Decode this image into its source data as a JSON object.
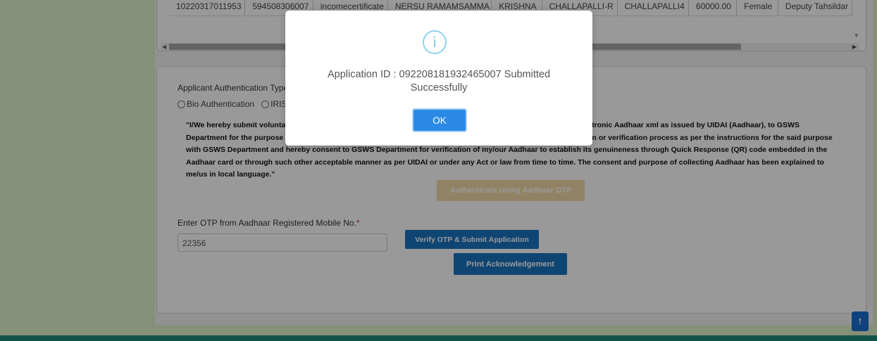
{
  "table": {
    "row": [
      "10220317011953",
      "594508306007",
      "incomecertificate",
      "NERSU RAMAMSAMMA",
      "KRISHNA",
      "CHALLAPALLI-R",
      "CHALLAPALLI4",
      "60000.00",
      "Female",
      "Deputy Tahsildar"
    ]
  },
  "form": {
    "auth_type_label": "Applicant Authentication Type",
    "radio_bio": "Bio Authentication",
    "radio_iris": "IRIS",
    "consent_text": "\"I/We hereby submit voluntarily my/our Aadhaar number, biometric information, one time pin (OTP) data and/or electronic Aadhaar xml as issued by UIDAI (Aadhaar), to GSWS Department for the purpose of authentication/identification through authentication process and/or offline verification or verification process as per the instructions for the said purpose with GSWS Department and hereby consent to GSWS Department for verification of my/our Aadhaar to establish its genuineness through Quick Response (QR) code embedded in the Aadhaar card or through such other acceptable manner as per UIDAI or under any Act or law from time to time. The consent and purpose of collecting Aadhaar has been explained to me/us in local language.\"",
    "auth_button": "Authenticate Using Aadhaar OTP",
    "otp_label": "Enter OTP from Aadhaar Registered Mobile No.",
    "otp_required": "*",
    "otp_value": "22356",
    "verify_button": "Verify OTP & Submit Application",
    "print_button": "Print Acknowledgement"
  },
  "modal": {
    "icon": "info-icon",
    "icon_glyph": "i",
    "message": "Application ID : 092208181932465007 Submitted Successfully",
    "ok_button": "OK"
  },
  "scroll_top_icon": "arrow-up-icon",
  "scroll_top_glyph": "🠕",
  "colors": {
    "primary": "#1a73c0",
    "disabled_button": "#f3d9a8",
    "modal_ok": "#2a8ae6",
    "page_bg": "#dfeec9",
    "footer": "#1f8a7a"
  }
}
